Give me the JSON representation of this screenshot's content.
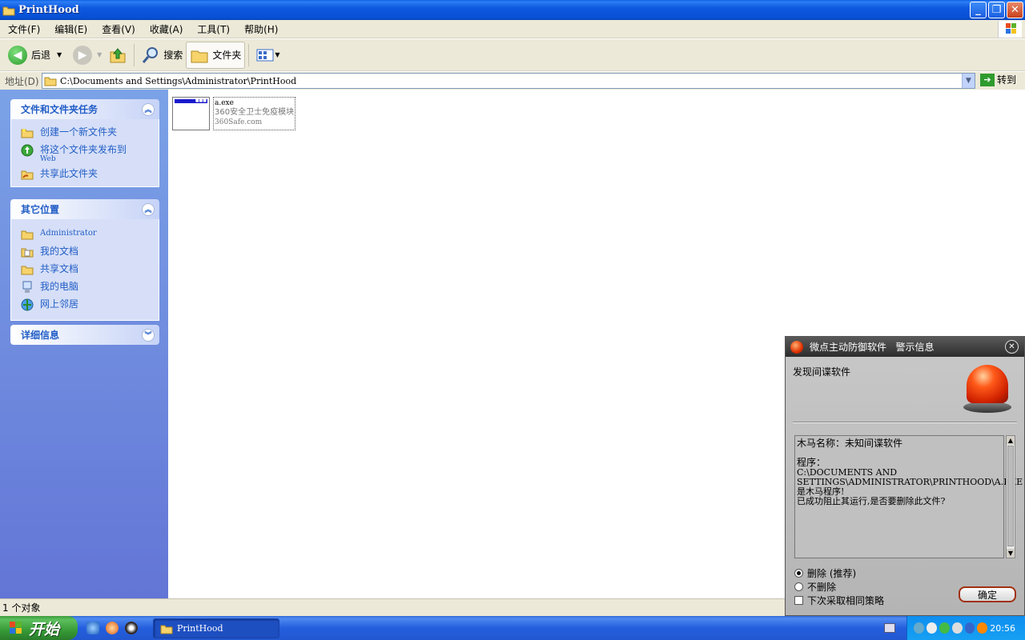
{
  "window": {
    "title": "PrintHood",
    "minimize": "_",
    "restore": "❐",
    "close": "✕"
  },
  "menu": [
    "文件(F)",
    "编辑(E)",
    "查看(V)",
    "收藏(A)",
    "工具(T)",
    "帮助(H)"
  ],
  "toolbar": {
    "back": "后退",
    "search": "搜索",
    "folders": "文件夹"
  },
  "address": {
    "label": "地址(D)",
    "path": "C:\\Documents and Settings\\Administrator\\PrintHood",
    "go": "转到"
  },
  "tasks_panel": {
    "title": "文件和文件夹任务",
    "items": [
      {
        "label": "创建一个新文件夹",
        "sub": ""
      },
      {
        "label": "将这个文件夹发布到",
        "sub": "Web"
      },
      {
        "label": "共享此文件夹",
        "sub": ""
      }
    ]
  },
  "places_panel": {
    "title": "其它位置",
    "items": [
      "Administrator",
      "我的文档",
      "共享文档",
      "我的电脑",
      "网上邻居"
    ]
  },
  "details_panel": {
    "title": "详细信息"
  },
  "file": {
    "name": "a.exe",
    "description": "360安全卫士免疫模块",
    "company": "360Safe.com"
  },
  "status": {
    "text": "1 个对象"
  },
  "taskbar": {
    "start": "开始",
    "task": "PrintHood",
    "clock": "20:56"
  },
  "alert": {
    "title": "微点主动防御软件   警示信息",
    "heading": "发现间谍软件",
    "lines": [
      "木马名称：未知间谍软件",
      "",
      "程序：",
      "C:\\DOCUMENTS AND",
      "SETTINGS\\ADMINISTRATOR\\PRINTHOOD\\A.EXE",
      "是木马程序!",
      "已成功阻止其运行,是否要删除此文件?"
    ],
    "option_delete": "删除 (推荐)",
    "option_keep": "不删除",
    "option_remember": "下次采取相同策略",
    "ok": "确定"
  }
}
